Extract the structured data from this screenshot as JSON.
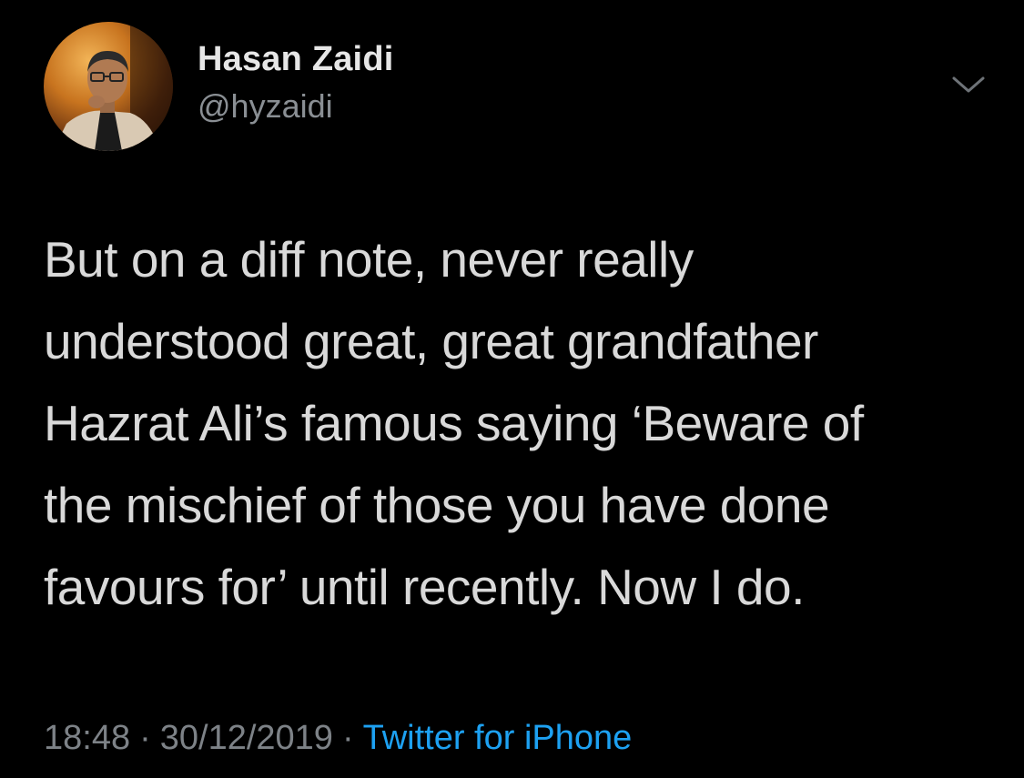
{
  "user": {
    "name": "Hasan Zaidi",
    "handle": "@hyzaidi",
    "avatar_icon": "profile-photo"
  },
  "menu": {
    "icon": "chevron-down-icon"
  },
  "tweet": {
    "lines": [
      "But on a diff note, never really",
      "understood great, great grandfather",
      "Hazrat Ali’s famous saying ‘Beware of",
      "the mischief of those you have done",
      "favours for’ until recently. Now I do."
    ]
  },
  "meta": {
    "time": "18:48",
    "separator": "·",
    "date": "30/12/2019",
    "source": "Twitter for iPhone"
  },
  "colors": {
    "background": "#000000",
    "text": "#d9d9d9",
    "muted": "#7d8287",
    "link": "#1da1f2"
  }
}
